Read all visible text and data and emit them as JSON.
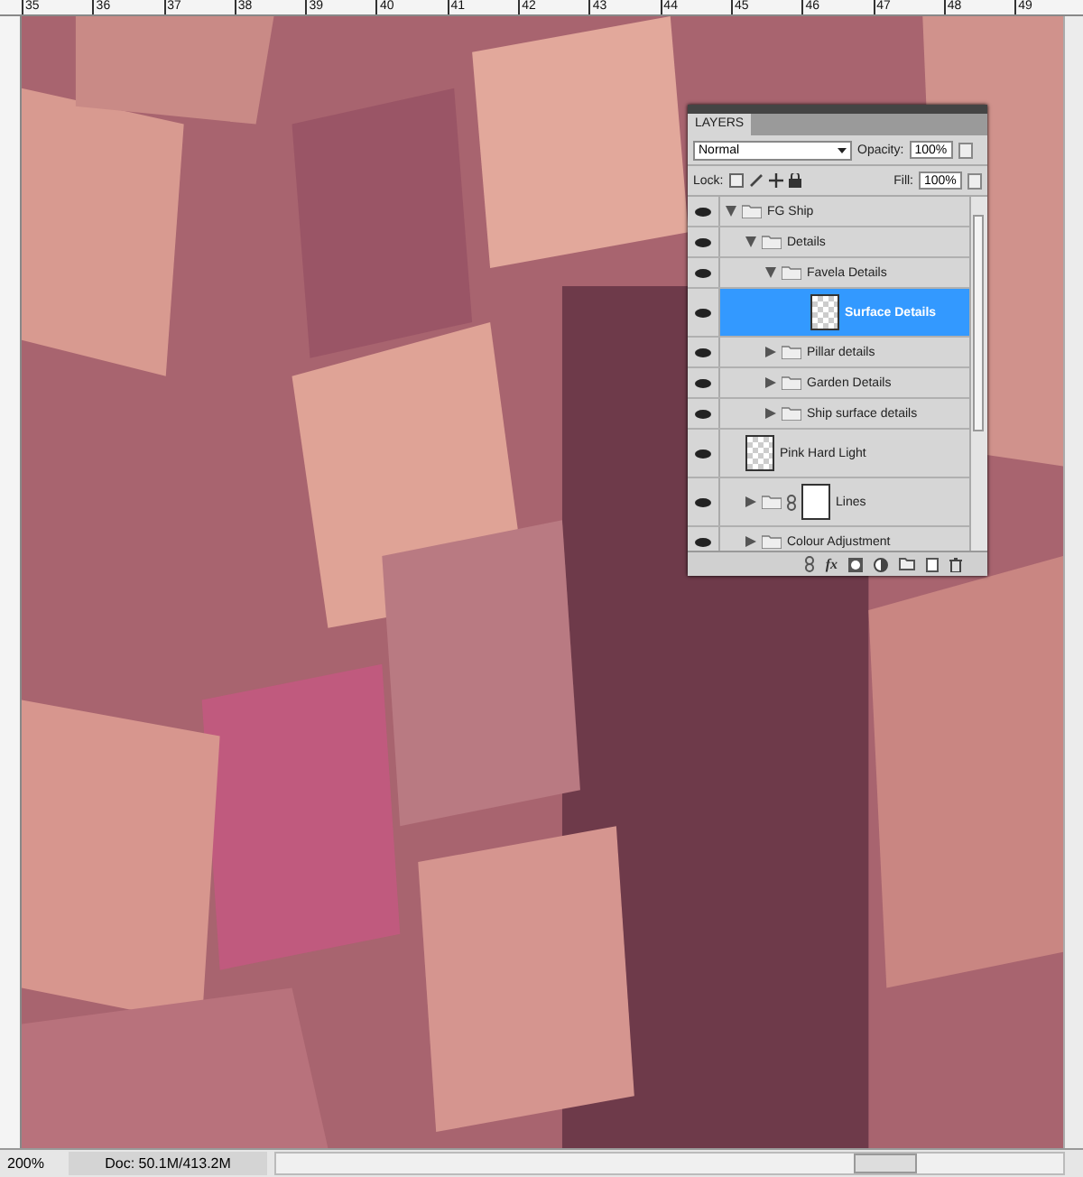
{
  "rulers": {
    "top_labels": [
      "35",
      "36",
      "37",
      "38",
      "39",
      "40",
      "41",
      "42",
      "43",
      "44",
      "45",
      "46",
      "47",
      "48",
      "49"
    ]
  },
  "layers_panel": {
    "title": "LAYERS",
    "blend_mode": "Normal",
    "opacity_label": "Opacity:",
    "opacity": "100%",
    "lock_label": "Lock:",
    "fill_label": "Fill:",
    "fill": "100%",
    "fx_label": "fx",
    "layers": [
      {
        "name": "FG Ship",
        "kind": "group",
        "visible": true,
        "expanded": true,
        "selected": false,
        "children": [
          {
            "name": "Details",
            "kind": "group",
            "visible": true,
            "expanded": true,
            "selected": false,
            "children": [
              {
                "name": "Favela Details",
                "kind": "group",
                "visible": true,
                "expanded": true,
                "selected": false,
                "children": [
                  {
                    "name": "Surface Details",
                    "kind": "layer",
                    "visible": true,
                    "selected": true
                  }
                ]
              },
              {
                "name": "Pillar details",
                "kind": "group",
                "visible": true,
                "expanded": false,
                "selected": false
              },
              {
                "name": "Garden Details",
                "kind": "group",
                "visible": true,
                "expanded": false,
                "selected": false
              },
              {
                "name": "Ship surface details",
                "kind": "group",
                "visible": true,
                "expanded": false,
                "selected": false
              }
            ]
          },
          {
            "name": "Pink Hard Light",
            "kind": "layer",
            "visible": true,
            "selected": false
          },
          {
            "name": "Lines",
            "kind": "masked_group",
            "visible": true,
            "expanded": false,
            "selected": false
          },
          {
            "name": "Colour Adjustment",
            "kind": "group",
            "visible": true,
            "expanded": false,
            "selected": false
          }
        ]
      }
    ]
  },
  "status_bar": {
    "zoom": "200%",
    "doc_info": "Doc: 50.1M/413.2M"
  }
}
